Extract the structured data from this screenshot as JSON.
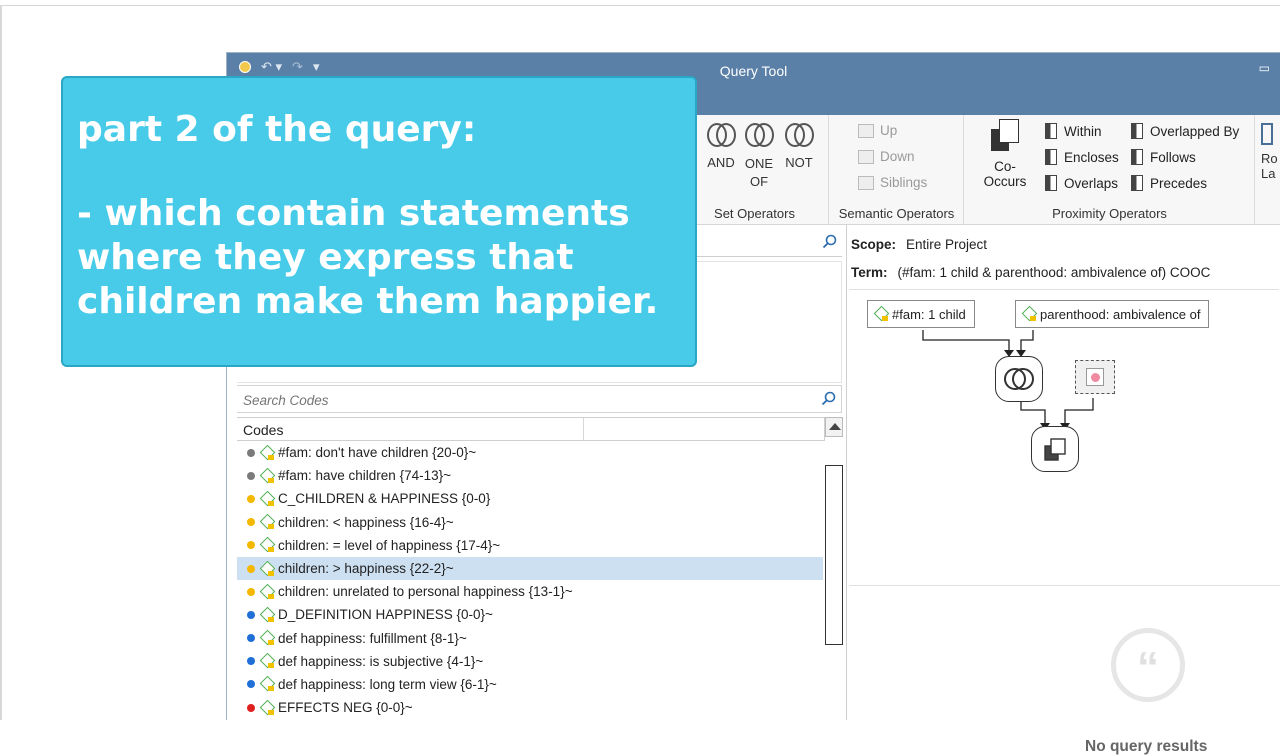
{
  "window": {
    "title": "Query Tool",
    "restore_glyph": "▭"
  },
  "ribbon": {
    "set_operators": {
      "ops": [
        "AND",
        "ONE OF",
        "NOT"
      ],
      "label": "Set Operators"
    },
    "semantic_operators": {
      "items": [
        "Up",
        "Down",
        "Siblings"
      ],
      "label": "Semantic Operators"
    },
    "proximity_operators": {
      "cooccurs": "Co-Occurs",
      "col1": [
        "Within",
        "Encloses",
        "Overlaps"
      ],
      "col2": [
        "Overlapped By",
        "Follows",
        "Precedes"
      ],
      "label": "Proximity Operators"
    },
    "right_edge": [
      "Ro",
      "La"
    ]
  },
  "codes_search": {
    "placeholder": "Search Codes",
    "header": "Codes"
  },
  "codes": [
    {
      "label": "#fam: don't have children {20-0}~",
      "color": "#7a7a7a"
    },
    {
      "label": "#fam: have children {74-13}~",
      "color": "#7a7a7a"
    },
    {
      "label": "C_CHILDREN & HAPPINESS {0-0}",
      "color": "#f5b800"
    },
    {
      "label": "children: < happiness {16-4}~",
      "color": "#f5b800"
    },
    {
      "label": "children: = level of happiness {17-4}~",
      "color": "#f5b800"
    },
    {
      "label": "children: > happiness {22-2}~",
      "color": "#f5b800",
      "selected": true
    },
    {
      "label": "children: unrelated to personal happiness {13-1}~",
      "color": "#f5b800"
    },
    {
      "label": "D_DEFINITION HAPPINESS {0-0}~",
      "color": "#1f6fd6"
    },
    {
      "label": "def happiness: fulfillment {8-1}~",
      "color": "#1f6fd6"
    },
    {
      "label": "def happiness: is subjective {4-1}~",
      "color": "#1f6fd6"
    },
    {
      "label": "def happiness: long term view {6-1}~",
      "color": "#1f6fd6"
    },
    {
      "label": "EFFECTS NEG {0-0}~",
      "color": "#e02020"
    }
  ],
  "query": {
    "scope_label": "Scope:",
    "scope_value": "Entire Project",
    "term_label": "Term:",
    "term_value": "(#fam: 1 child & parenthood: ambivalence of) COOC",
    "operand1": "#fam: 1 child",
    "operand2": "parenthood: ambivalence of",
    "no_results": "No query results"
  },
  "callout": {
    "line1": "part 2 of the query:",
    "line2": "- which contain statements\nwhere they express that\nchildren make them happier."
  }
}
